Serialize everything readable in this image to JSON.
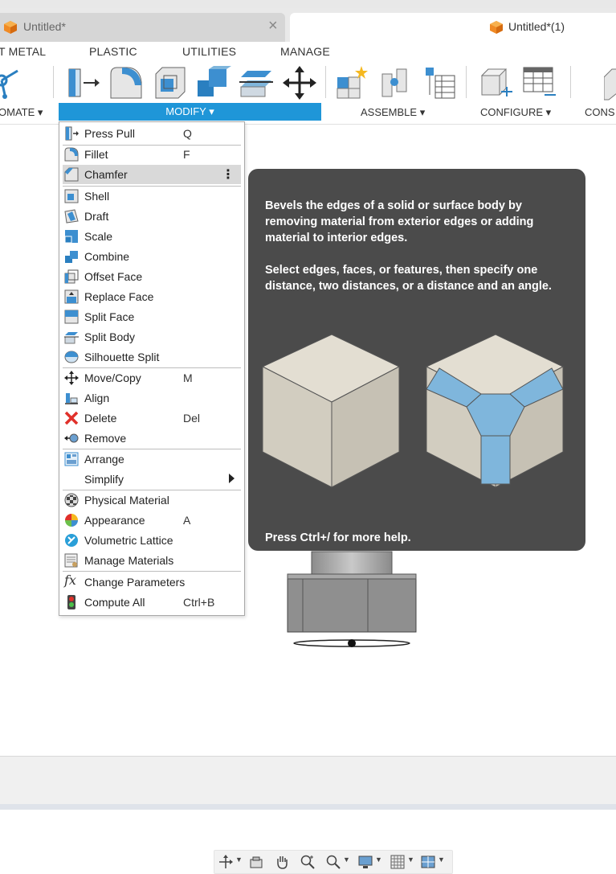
{
  "tabs": [
    {
      "label": "Untitled*",
      "active": false
    },
    {
      "label": "Untitled*(1)",
      "active": true
    }
  ],
  "ribbon": {
    "tabs": [
      "T METAL",
      "PLASTIC",
      "UTILITIES",
      "MANAGE"
    ],
    "groups": {
      "automate": "OMATE ▾",
      "modify": "MODIFY ▾",
      "assemble": "ASSEMBLE ▾",
      "configure": "CONFIGURE ▾",
      "construct": "CONS"
    }
  },
  "menu": {
    "items": [
      {
        "label": "Press Pull",
        "shortcut": "Q",
        "icon": "press-pull-icon"
      },
      {
        "label": "Fillet",
        "shortcut": "F",
        "icon": "fillet-icon"
      },
      {
        "label": "Chamfer",
        "shortcut": "",
        "icon": "chamfer-icon",
        "highlighted": true
      },
      {
        "label": "Shell",
        "shortcut": "",
        "icon": "shell-icon"
      },
      {
        "label": "Draft",
        "shortcut": "",
        "icon": "draft-icon"
      },
      {
        "label": "Scale",
        "shortcut": "",
        "icon": "scale-icon"
      },
      {
        "label": "Combine",
        "shortcut": "",
        "icon": "combine-icon"
      },
      {
        "label": "Offset Face",
        "shortcut": "",
        "icon": "offset-face-icon"
      },
      {
        "label": "Replace Face",
        "shortcut": "",
        "icon": "replace-face-icon"
      },
      {
        "label": "Split Face",
        "shortcut": "",
        "icon": "split-face-icon"
      },
      {
        "label": "Split Body",
        "shortcut": "",
        "icon": "split-body-icon"
      },
      {
        "label": "Silhouette Split",
        "shortcut": "",
        "icon": "silhouette-split-icon"
      },
      {
        "label": "Move/Copy",
        "shortcut": "M",
        "icon": "move-copy-icon"
      },
      {
        "label": "Align",
        "shortcut": "",
        "icon": "align-icon"
      },
      {
        "label": "Delete",
        "shortcut": "Del",
        "icon": "delete-icon"
      },
      {
        "label": "Remove",
        "shortcut": "",
        "icon": "remove-icon"
      },
      {
        "label": "Arrange",
        "shortcut": "",
        "icon": "arrange-icon"
      },
      {
        "label": "Simplify",
        "shortcut": "",
        "icon": "simplify-submenu-arrow-icon"
      },
      {
        "label": "Physical Material",
        "shortcut": "",
        "icon": "physical-material-icon"
      },
      {
        "label": "Appearance",
        "shortcut": "A",
        "icon": "appearance-icon"
      },
      {
        "label": "Volumetric Lattice",
        "shortcut": "",
        "icon": "volumetric-lattice-icon"
      },
      {
        "label": "Manage Materials",
        "shortcut": "",
        "icon": "manage-materials-icon"
      },
      {
        "label": "Change Parameters",
        "shortcut": "",
        "icon": "fx-parameters-icon"
      },
      {
        "label": "Compute All",
        "shortcut": "Ctrl+B",
        "icon": "compute-all-icon"
      }
    ]
  },
  "tooltip": {
    "paragraph1": "Bevels the edges of a solid or surface body by removing material from exterior edges or adding material to interior edges.",
    "paragraph2": "Select edges, faces, or features, then specify one distance, two distances, or a distance and an angle.",
    "help": "Press Ctrl+/ for more help."
  },
  "colors": {
    "accent": "#1f96d8",
    "tooltip_bg": "#4b4b4b",
    "chamfer_blue": "#7fb6dc",
    "cube_face": "#ddd8cc"
  }
}
